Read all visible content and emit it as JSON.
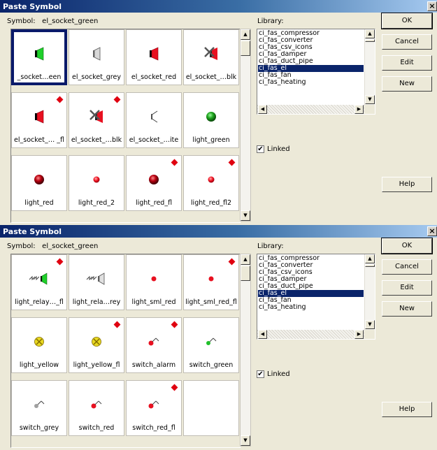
{
  "dialogs": [
    {
      "title": "Paste Symbol",
      "close": "×",
      "symbol_label": "Symbol:",
      "symbol_value": "el_socket_green",
      "library_label": "Library:",
      "library_items": [
        "ci_fas_compressor",
        "ci_fas_converter",
        "ci_fas_csv_icons",
        "ci_fas_damper",
        "ci_fas_duct_pipe",
        "ci_fas_el",
        "ci_fas_fan",
        "ci_fas_heating"
      ],
      "library_selected": "ci_fas_el",
      "buttons": {
        "ok": "OK",
        "cancel": "Cancel",
        "edit": "Edit",
        "new": "New",
        "help": "Help"
      },
      "linked_label": "Linked",
      "linked_checked": true,
      "tiles": [
        {
          "caption": "_socket…een",
          "icon": "socket-green-icon",
          "flag": false,
          "selected": true
        },
        {
          "caption": "el_socket_grey",
          "icon": "socket-grey-icon",
          "flag": false
        },
        {
          "caption": "el_socket_red",
          "icon": "socket-red-icon",
          "flag": false
        },
        {
          "caption": "el_socket_…blk",
          "icon": "socket-crossed-icon",
          "flag": false
        },
        {
          "caption": "el_socket_… _fl",
          "icon": "socket-red-icon",
          "flag": true
        },
        {
          "caption": "el_socket_…blk",
          "icon": "socket-crossed-icon",
          "flag": true
        },
        {
          "caption": "el_socket_…ite",
          "icon": "socket-white-icon",
          "flag": false
        },
        {
          "caption": "light_green",
          "icon": "light-green-icon",
          "flag": false
        },
        {
          "caption": "light_red",
          "icon": "light-red-icon",
          "flag": false
        },
        {
          "caption": "light_red_2",
          "icon": "light-red-small-icon",
          "flag": false
        },
        {
          "caption": "light_red_fl",
          "icon": "light-red-icon",
          "flag": true
        },
        {
          "caption": "light_red_fl2",
          "icon": "light-red-small-icon",
          "flag": true
        }
      ]
    },
    {
      "title": "Paste Symbol",
      "close": "×",
      "symbol_label": "Symbol:",
      "symbol_value": "el_socket_green",
      "library_label": "Library:",
      "library_items": [
        "ci_fas_compressor",
        "ci_fas_converter",
        "ci_fas_csv_icons",
        "ci_fas_damper",
        "ci_fas_duct_pipe",
        "ci_fas_el",
        "ci_fas_fan",
        "ci_fas_heating"
      ],
      "library_selected": "ci_fas_el",
      "buttons": {
        "ok": "OK",
        "cancel": "Cancel",
        "edit": "Edit",
        "new": "New",
        "help": "Help"
      },
      "linked_label": "Linked",
      "linked_checked": true,
      "tiles": [
        {
          "caption": "light_relay…_fl",
          "icon": "relay-green-icon",
          "flag": true
        },
        {
          "caption": "light_rela…rey",
          "icon": "relay-grey-icon",
          "flag": false
        },
        {
          "caption": "light_sml_red",
          "icon": "dot-red-icon",
          "flag": false
        },
        {
          "caption": "light_sml_red_fl",
          "icon": "dot-red-icon",
          "flag": true
        },
        {
          "caption": "light_yellow",
          "icon": "light-yellow-icon",
          "flag": false
        },
        {
          "caption": "light_yellow_fl",
          "icon": "light-yellow-icon",
          "flag": true
        },
        {
          "caption": "switch_alarm",
          "icon": "switch-red-icon",
          "flag": true
        },
        {
          "caption": "switch_green",
          "icon": "switch-green-icon",
          "flag": false
        },
        {
          "caption": "switch_grey",
          "icon": "switch-grey-icon",
          "flag": false
        },
        {
          "caption": "switch_red",
          "icon": "switch-red-icon",
          "flag": false
        },
        {
          "caption": "switch_red_fl",
          "icon": "switch-red-icon",
          "flag": true
        },
        {
          "caption": "",
          "icon": "",
          "flag": false
        }
      ]
    }
  ],
  "colors": {
    "title_bar": "#0a246a",
    "selection": "#0a246a",
    "flag": "#e00010",
    "face": "#ece9d8"
  }
}
